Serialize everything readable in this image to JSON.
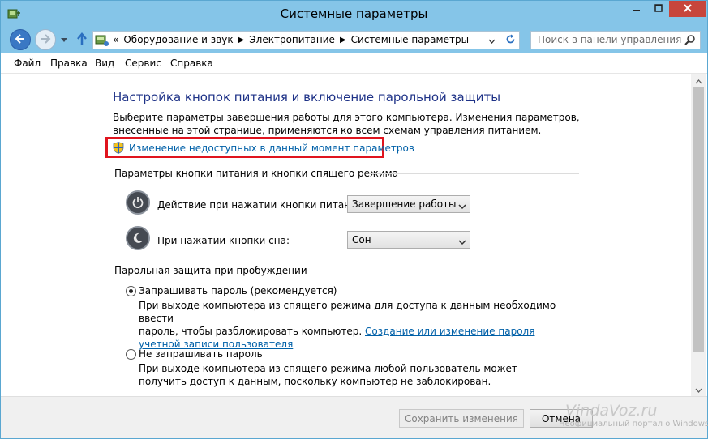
{
  "window": {
    "title": "Системные параметры",
    "colors": {
      "frame": "#85c5e8",
      "close": "#c7463c",
      "title_text": "#1e3287",
      "link": "#0060a8",
      "highlight": "#e0141e"
    }
  },
  "address_bar": {
    "prefix": "«",
    "crumbs": [
      "Оборудование и звук",
      "Электропитание",
      "Системные параметры"
    ],
    "search_placeholder": "Поиск в панели управления"
  },
  "menu": {
    "items": [
      "Файл",
      "Правка",
      "Вид",
      "Сервис",
      "Справка"
    ]
  },
  "main": {
    "title": "Настройка кнопок питания и включение парольной защиты",
    "description": "Выберите параметры завершения работы для этого компьютера. Изменения параметров, внесенные на этой странице, применяются ко всем схемам управления питанием.",
    "change_link": "Изменение недоступных в данный момент параметров",
    "power_section": {
      "heading": "Параметры кнопки питания и кнопки спящего режима",
      "power_button": {
        "label": "Действие при нажатии кнопки питания:",
        "value": "Завершение работы",
        "icon": "power-icon"
      },
      "sleep_button": {
        "label": "При нажатии кнопки сна:",
        "value": "Сон",
        "icon": "sleep-moon-icon"
      }
    },
    "password_section": {
      "heading": "Парольная защита при пробуждении",
      "option_require": {
        "label": "Запрашивать пароль (рекомендуется)",
        "selected": true,
        "desc_line1": "При выходе компьютера из спящего режима для доступа к данным необходимо ввести",
        "desc_line2_text": "пароль, чтобы разблокировать компьютер.",
        "desc_link": "Создание или изменение пароля учетной записи пользователя"
      },
      "option_none": {
        "label": "Не запрашивать пароль",
        "selected": false,
        "description": "При выходе компьютера из спящего режима любой пользователь может получить доступ к данным, поскольку компьютер не заблокирован."
      }
    }
  },
  "footer": {
    "save_label": "Сохранить изменения",
    "cancel_label": "Отмена"
  },
  "watermark": {
    "site": "VindaVoz.ru",
    "tagline": "Неофициальный портал о Windows"
  }
}
